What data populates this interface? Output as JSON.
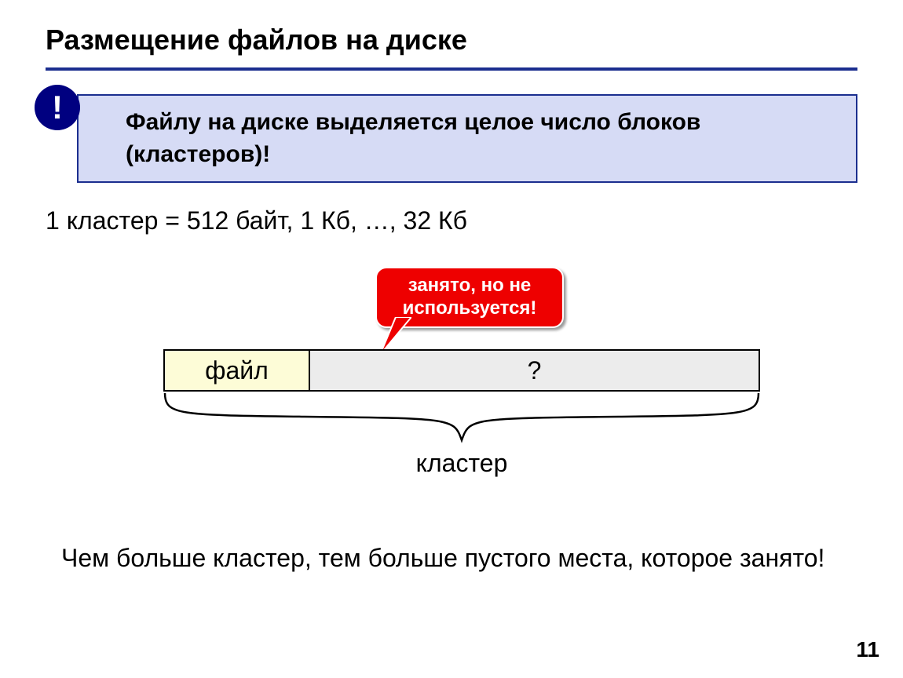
{
  "title": "Размещение файлов на диске",
  "badge": "!",
  "callout": "Файлу на диске выделяется целое число блоков (кластеров)!",
  "cluster_sizes": "1 кластер = 512 байт, 1 Кб, …, 32 Кб",
  "bubble_line1": "занято, но не",
  "bubble_line2": "используется!",
  "cell_file": "файл",
  "cell_rest": "?",
  "brace_label": "кластер",
  "bottom": "Чем больше кластер, тем больше пустого места, которое занято!",
  "page": "11"
}
